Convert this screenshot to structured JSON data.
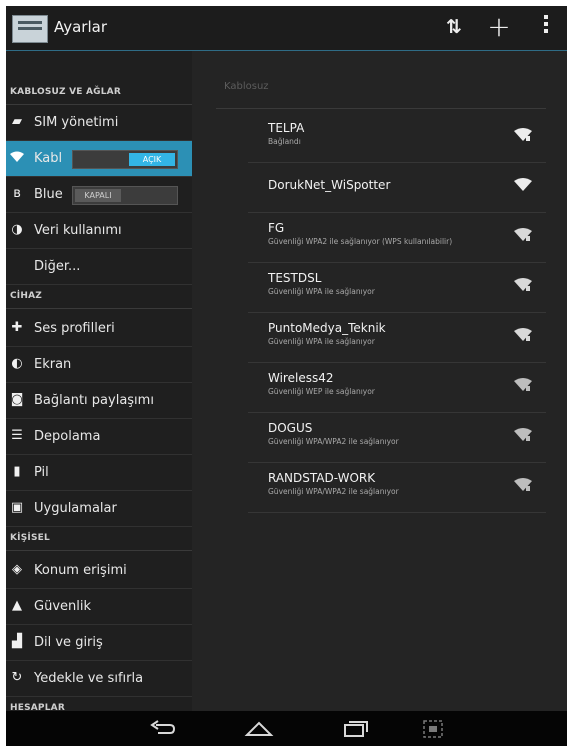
{
  "app": {
    "title": "Ayarlar"
  },
  "actions": {
    "sync": "sync-icon",
    "add": "add-icon",
    "overflow": "overflow-icon"
  },
  "sidebar": {
    "sections": [
      {
        "header": "KABLOSUZ VE AĞLAR"
      },
      {
        "header": "CİHAZ"
      },
      {
        "header": "KİŞİSEL"
      },
      {
        "header": "HESAPLAR"
      }
    ],
    "items": [
      {
        "label": "SIM yönetimi",
        "icon": "sim-icon"
      },
      {
        "label": "Kabl",
        "icon": "wifi-icon",
        "toggle": "AÇIK"
      },
      {
        "label": "Blue",
        "icon": "bluetooth-icon",
        "toggle": "KAPALI"
      },
      {
        "label": "Veri kullanımı",
        "icon": "data-usage-icon"
      },
      {
        "label": "Diğer...",
        "icon": ""
      },
      {
        "label": "Ses profilleri",
        "icon": "sound-icon"
      },
      {
        "label": "Ekran",
        "icon": "display-icon"
      },
      {
        "label": "Bağlantı paylaşımı",
        "icon": "tethering-icon"
      },
      {
        "label": "Depolama",
        "icon": "storage-icon"
      },
      {
        "label": "Pil",
        "icon": "battery-icon"
      },
      {
        "label": "Uygulamalar",
        "icon": "apps-icon"
      },
      {
        "label": "Konum erişimi",
        "icon": "location-icon"
      },
      {
        "label": "Güvenlik",
        "icon": "lock-icon"
      },
      {
        "label": "Dil ve giriş",
        "icon": "language-icon"
      },
      {
        "label": "Yedekle ve sıfırla",
        "icon": "backup-icon"
      }
    ]
  },
  "content": {
    "header": "Kablosuz",
    "networks": [
      {
        "ssid": "TELPA",
        "status": "Bağlandı"
      },
      {
        "ssid": "DorukNet_WiSpotter",
        "status": ""
      },
      {
        "ssid": "FG",
        "status": "Güvenliği WPA2 ile sağlanıyor (WPS kullanılabilir)"
      },
      {
        "ssid": "TESTDSL",
        "status": "Güvenliği WPA ile sağlanıyor"
      },
      {
        "ssid": "PuntoMedya_Teknik",
        "status": "Güvenliği WPA ile sağlanıyor"
      },
      {
        "ssid": "Wireless42",
        "status": "Güvenliği WEP ile sağlanıyor"
      },
      {
        "ssid": "DOGUS",
        "status": "Güvenliği WPA/WPA2 ile sağlanıyor"
      },
      {
        "ssid": "RANDSTAD-WORK",
        "status": "Güvenliği WPA/WPA2 ile sağlanıyor"
      }
    ]
  },
  "navbar": {
    "back": "back-icon",
    "home": "home-icon",
    "recents": "recents-icon",
    "screenshot": "screenshot-icon"
  },
  "colors": {
    "accent": "#33b5e5",
    "selected_bg": "#2c90b5",
    "panel_bg": "#242424",
    "sidebar_bg": "#1f1f1f"
  }
}
